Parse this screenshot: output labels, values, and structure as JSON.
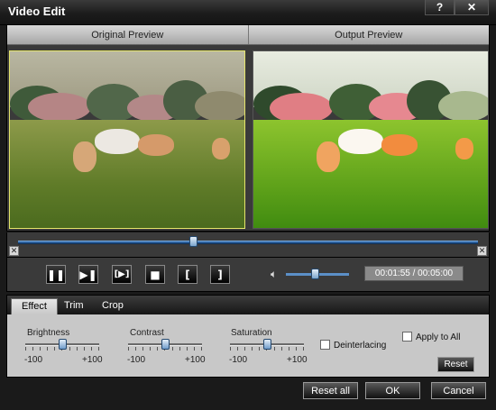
{
  "window": {
    "title": "Video Edit",
    "help_symbol": "?",
    "close_symbol": "✕"
  },
  "preview": {
    "original_label": "Original Preview",
    "output_label": "Output Preview"
  },
  "player": {
    "time_display": "00:01:55 / 00:05:00",
    "seek_progress_fraction": 0.38,
    "volume_fraction": 0.45,
    "buttons": [
      {
        "name": "pause-button",
        "icon": "pause-icon",
        "glyph": "❚❚"
      },
      {
        "name": "next-frame-button",
        "icon": "next-frame-icon",
        "glyph": "▶❚"
      },
      {
        "name": "snapshot-frame-button",
        "icon": "frame-step-icon",
        "glyph": "[▶]"
      },
      {
        "name": "stop-button",
        "icon": "stop-icon",
        "glyph": "■"
      },
      {
        "name": "set-start-button",
        "icon": "bracket-left-icon",
        "glyph": "["
      },
      {
        "name": "set-end-button",
        "icon": "bracket-right-icon",
        "glyph": "]"
      }
    ]
  },
  "tabs": [
    {
      "label": "Effect",
      "active": true
    },
    {
      "label": "Trim",
      "active": false
    },
    {
      "label": "Crop",
      "active": false
    }
  ],
  "effect": {
    "brightness": {
      "label": "Brightness",
      "min": "-100",
      "max": "+100",
      "value": 0
    },
    "contrast": {
      "label": "Contrast",
      "min": "-100",
      "max": "+100",
      "value": 0
    },
    "saturation": {
      "label": "Saturation",
      "min": "-100",
      "max": "+100",
      "value": 0
    },
    "deinterlacing_label": "Deinterlacing",
    "apply_to_all_label": "Apply to All",
    "reset_label": "Reset"
  },
  "footer": {
    "reset_all_label": "Reset all",
    "ok_label": "OK",
    "cancel_label": "Cancel"
  },
  "colors": {
    "accent": "#2a5f9c",
    "slider_thumb": "#7aa4cc",
    "selected_border": "#e4e46a"
  }
}
